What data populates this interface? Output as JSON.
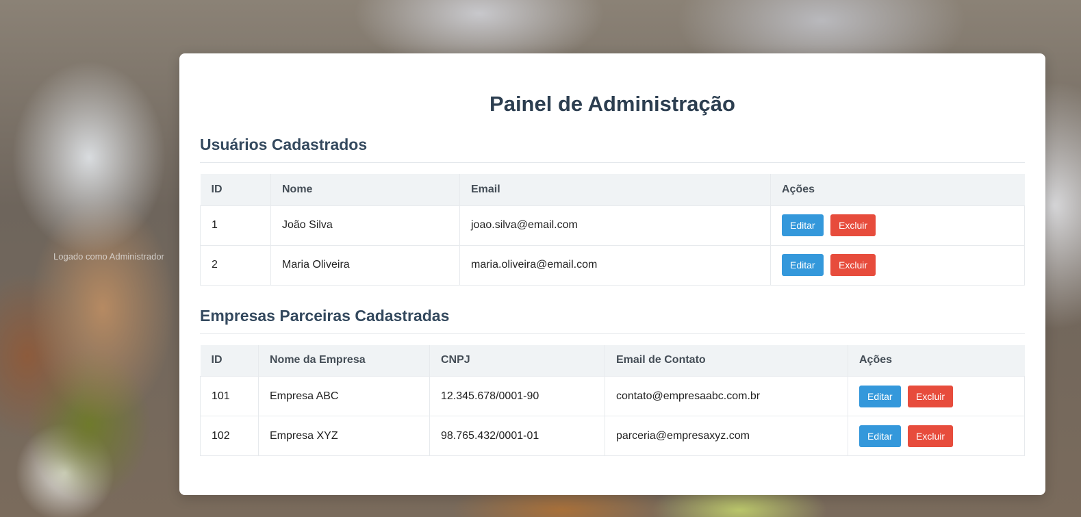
{
  "background": {
    "logged_in_text": "Logado como Administrador"
  },
  "page": {
    "title": "Painel de Administração"
  },
  "colors": {
    "title": "#2c3e50",
    "edit_button": "#3498db",
    "delete_button": "#e74c3c",
    "table_header_bg": "#f0f3f5"
  },
  "users": {
    "section_title": "Usuários Cadastrados",
    "headers": [
      "ID",
      "Nome",
      "Email",
      "Ações"
    ],
    "rows": [
      {
        "id": "1",
        "name": "João Silva",
        "email": "joao.silva@email.com",
        "edit_label": "Editar",
        "delete_label": "Excluir"
      },
      {
        "id": "2",
        "name": "Maria Oliveira",
        "email": "maria.oliveira@email.com",
        "edit_label": "Editar",
        "delete_label": "Excluir"
      }
    ]
  },
  "companies": {
    "section_title": "Empresas Parceiras Cadastradas",
    "headers": [
      "ID",
      "Nome da Empresa",
      "CNPJ",
      "Email de Contato",
      "Ações"
    ],
    "rows": [
      {
        "id": "101",
        "name": "Empresa ABC",
        "cnpj": "12.345.678/0001-90",
        "email": "contato@empresaabc.com.br",
        "edit_label": "Editar",
        "delete_label": "Excluir"
      },
      {
        "id": "102",
        "name": "Empresa XYZ",
        "cnpj": "98.765.432/0001-01",
        "email": "parceria@empresaxyz.com",
        "edit_label": "Editar",
        "delete_label": "Excluir"
      }
    ]
  }
}
